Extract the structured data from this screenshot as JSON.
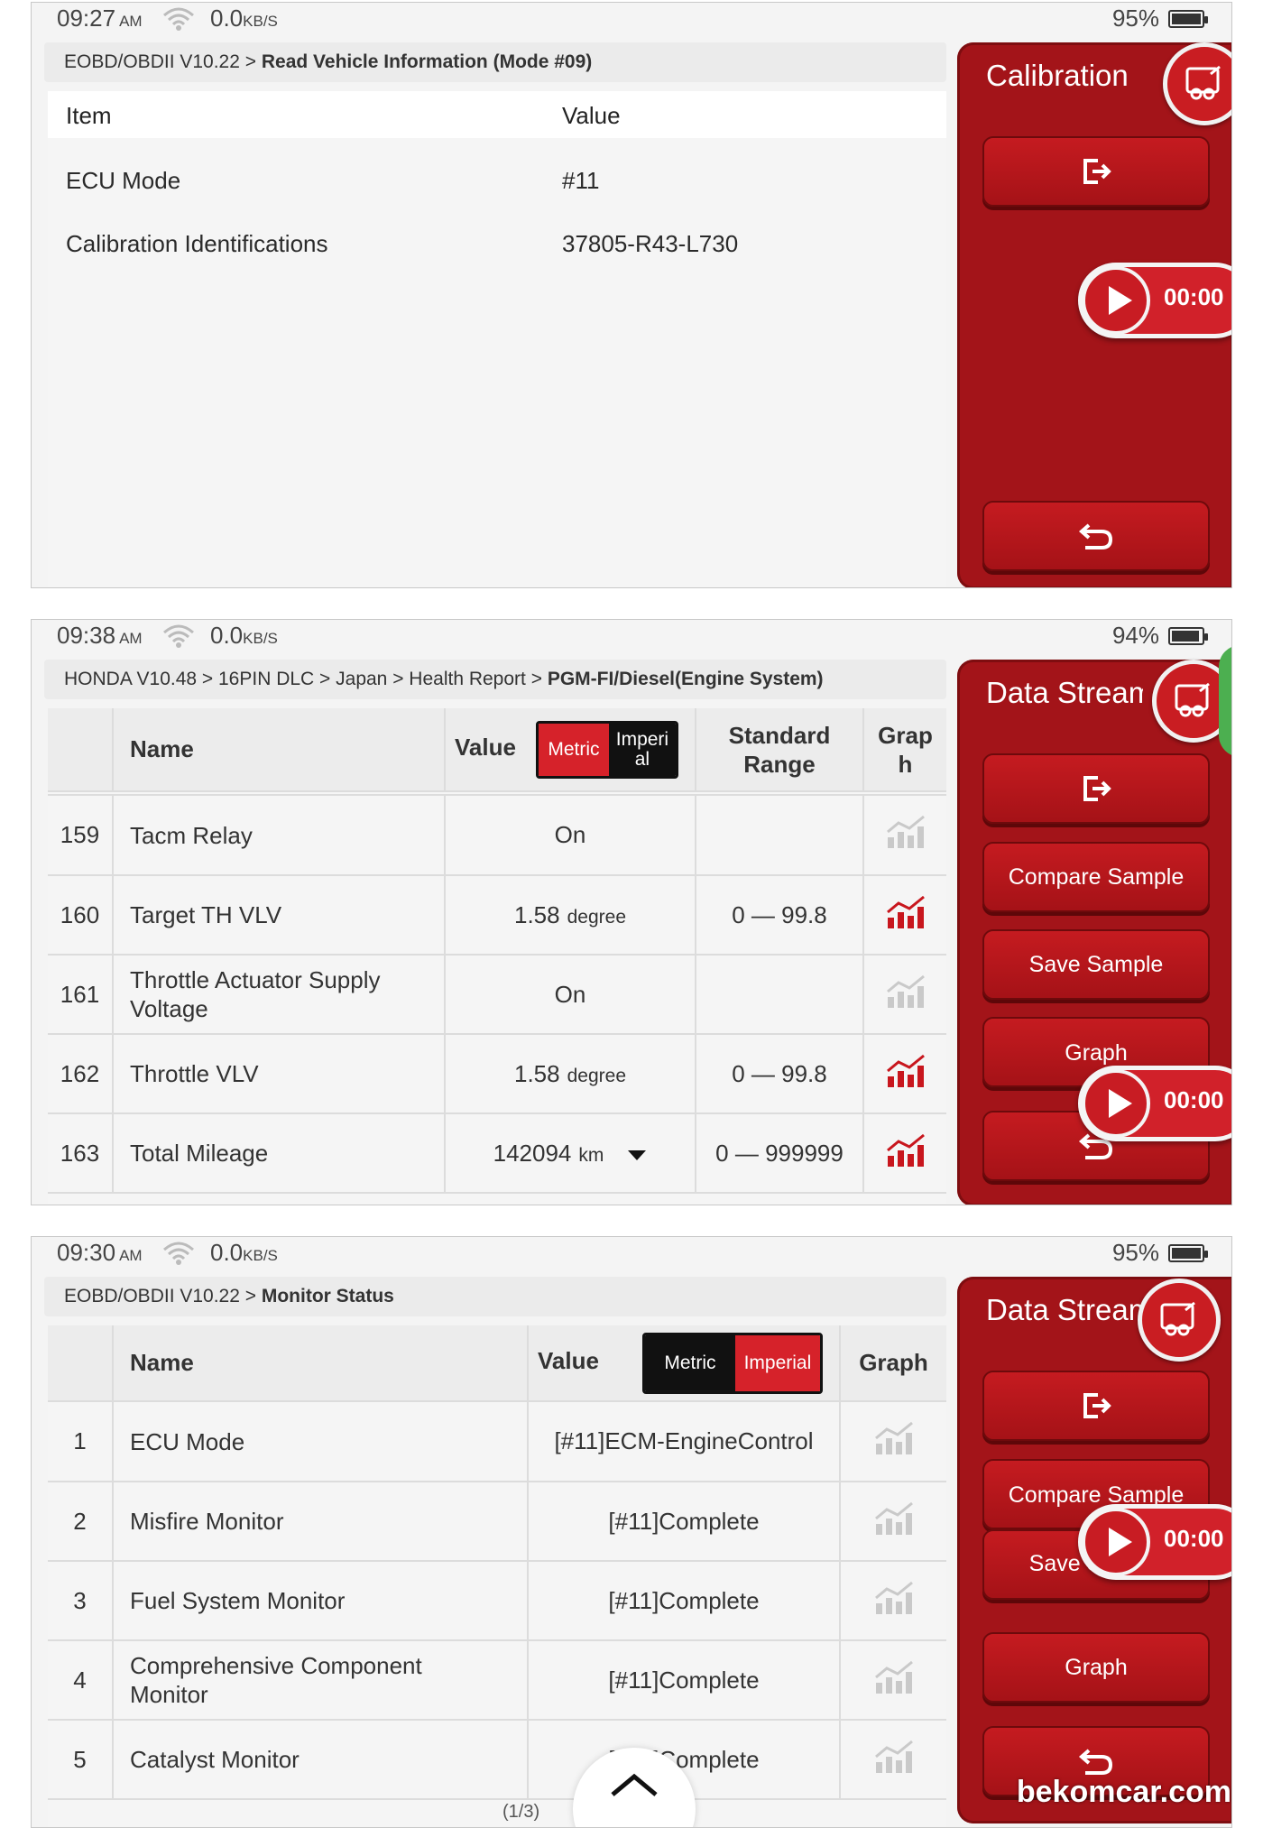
{
  "screens": [
    {
      "status": {
        "time": "09:27",
        "ampm": "AM",
        "net": "0.0",
        "net_unit": "KB/S",
        "battery": "95%"
      },
      "breadcrumb": {
        "path": "EOBD/OBDII V10.22 > ",
        "current": "Read Vehicle Information (Mode #09)"
      },
      "table": {
        "headers": [
          "Item",
          "Value"
        ],
        "rows": [
          {
            "item": "ECU Mode",
            "value": "#11"
          },
          {
            "item": "Calibration Identifications",
            "value": "37805-R43-L730"
          }
        ]
      },
      "panel": {
        "title": "Calibration",
        "timer": "00:00"
      }
    },
    {
      "status": {
        "time": "09:38",
        "ampm": "AM",
        "net": "0.0",
        "net_unit": "KB/S",
        "battery": "94%"
      },
      "breadcrumb": {
        "path": "HONDA V10.48 > 16PIN DLC > Japan > Health Report > ",
        "current": "PGM-FI/Diesel(Engine System)"
      },
      "table": {
        "headers": {
          "name": "Name",
          "value": "Value",
          "metric": "Metric",
          "imperial_1": "Imperi",
          "imperial_2": "al",
          "range_1": "Standard",
          "range_2": "Range",
          "graph_1": "Grap",
          "graph_2": "h"
        },
        "rows": [
          {
            "num": "159",
            "name": "Tacm Relay",
            "name2": "",
            "value": "On",
            "unit": "",
            "range": "",
            "graph_active": false
          },
          {
            "num": "160",
            "name": "Target TH VLV",
            "name2": "",
            "value": "1.58",
            "unit": "degree",
            "range": "0 — 99.8",
            "graph_active": true
          },
          {
            "num": "161",
            "name": "Throttle Actuator Supply",
            "name2": "Voltage",
            "value": "On",
            "unit": "",
            "range": "",
            "graph_active": false
          },
          {
            "num": "162",
            "name": "Throttle VLV",
            "name2": "",
            "value": "1.58",
            "unit": "degree",
            "range": "0 — 99.8",
            "graph_active": true
          },
          {
            "num": "163",
            "name": "Total Mileage",
            "name2": "",
            "value": "142094",
            "unit": "km",
            "range": "0 — 999999",
            "graph_active": true
          }
        ]
      },
      "panel": {
        "title": "Data Stream",
        "compare": "Compare Sample",
        "save": "Save Sample",
        "graph": "Graph",
        "timer": "00:00"
      }
    },
    {
      "status": {
        "time": "09:30",
        "ampm": "AM",
        "net": "0.0",
        "net_unit": "KB/S",
        "battery": "95%"
      },
      "breadcrumb": {
        "path": "EOBD/OBDII V10.22 > ",
        "current": "Monitor Status"
      },
      "table": {
        "headers": {
          "name": "Name",
          "value": "Value",
          "metric": "Metric",
          "imperial": "Imperial",
          "graph": "Graph"
        },
        "rows": [
          {
            "num": "1",
            "name": "ECU Mode",
            "name2": "",
            "value": "[#11]ECM-EngineControl"
          },
          {
            "num": "2",
            "name": "Misfire Monitor",
            "name2": "",
            "value": "[#11]Complete"
          },
          {
            "num": "3",
            "name": "Fuel System Monitor",
            "name2": "",
            "value": "[#11]Complete"
          },
          {
            "num": "4",
            "name": "Comprehensive Component",
            "name2": "Monitor",
            "value": "[#11]Complete"
          },
          {
            "num": "5",
            "name": "Catalyst Monitor",
            "name2": "",
            "value": "[#11]Complete"
          }
        ],
        "page": "(1/3)"
      },
      "panel": {
        "title": "Data Stream",
        "compare": "Compare Sample",
        "save": "Save Sample",
        "graph": "Graph",
        "timer": "00:00"
      }
    }
  ],
  "watermark": "bekomcar.com",
  "colors": {
    "accent_red": "#c91d22",
    "panel_red": "#a31419",
    "toggle_dark": "#111111"
  },
  "icons": [
    "wifi-icon",
    "battery-icon",
    "car-snapshot-icon",
    "exit-icon",
    "back-icon",
    "play-icon",
    "graph-icon",
    "dropdown-icon",
    "chevron-up-icon",
    "check-icon",
    "scroll-top-icon"
  ]
}
